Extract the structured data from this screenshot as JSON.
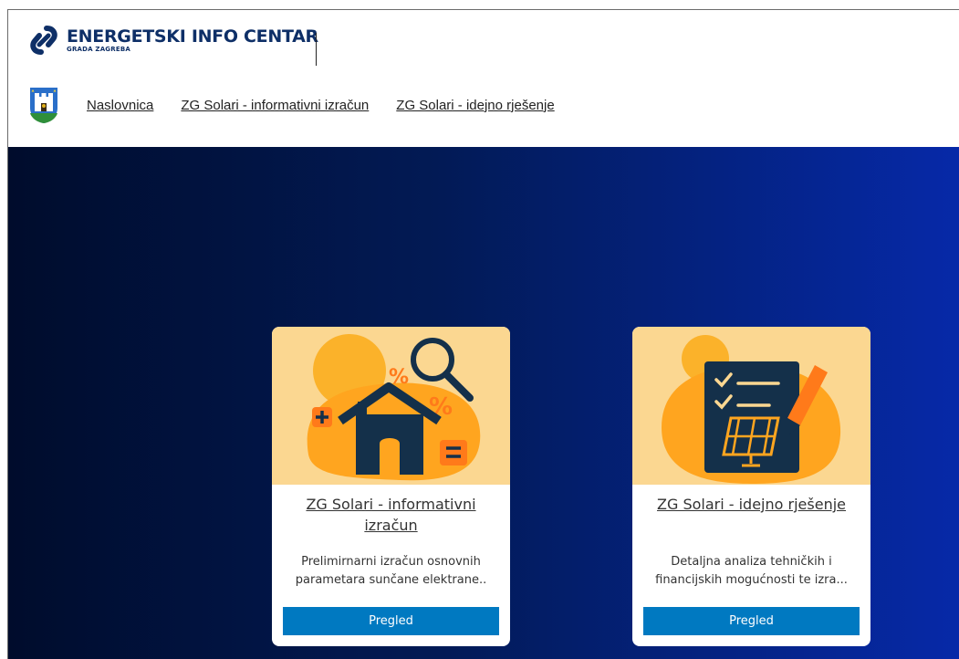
{
  "header": {
    "logo_title": "ENERGETSKI INFO CENTAR",
    "logo_subtitle": "GRADA ZAGREBA",
    "brand_color": "#0e2f67"
  },
  "nav": {
    "items": [
      {
        "label": "Naslovnica"
      },
      {
        "label": "ZG Solari - informativni izračun"
      },
      {
        "label": "ZG Solari - idejno rješenje"
      }
    ]
  },
  "hero": {
    "gradient_start": "#000c2c",
    "gradient_end": "#0629a8"
  },
  "cards": [
    {
      "title": "ZG Solari - informativni izračun",
      "description": "Prelimirnarni izračun osnovnih parametara sunčane elektrane..",
      "button": "Pregled",
      "icon": "house-calculator-icon"
    },
    {
      "title": "ZG Solari - idejno rješenje",
      "description": "Detaljna analiza tehničkih i financijskih mogućnosti te izra...",
      "button": "Pregled",
      "icon": "checklist-solar-panel-icon"
    }
  ],
  "colors": {
    "button": "#0079c1",
    "card_image_bg": "#fbd791"
  }
}
